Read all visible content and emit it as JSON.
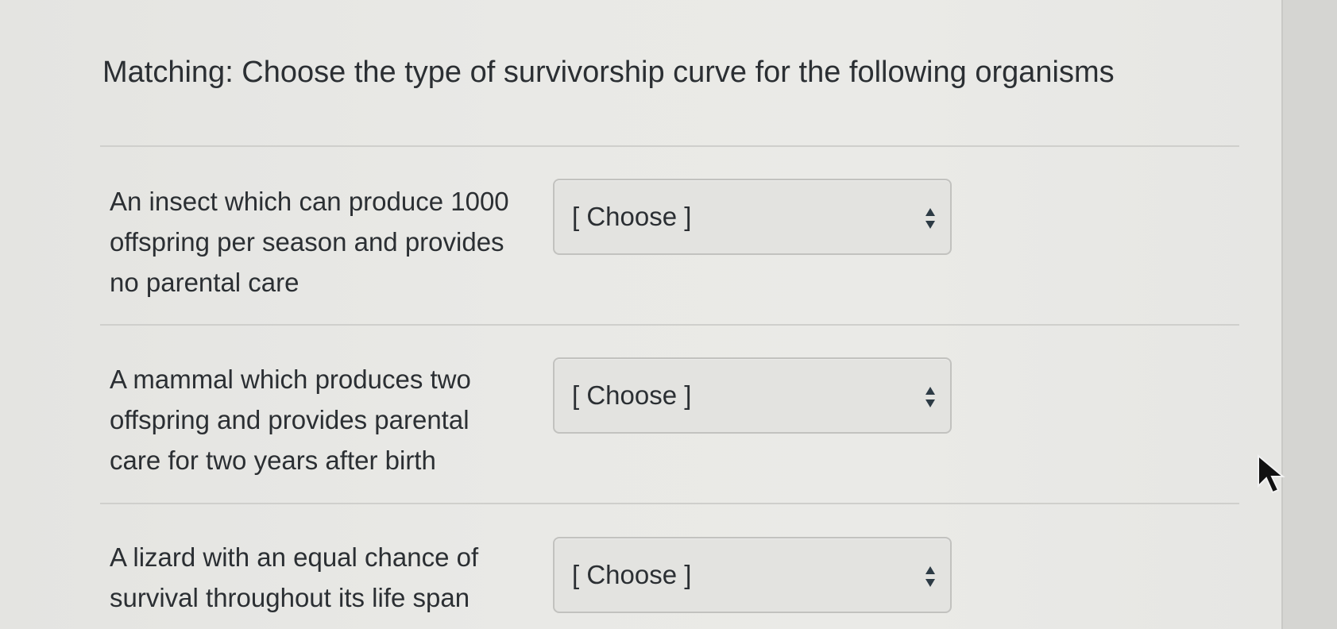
{
  "question": {
    "title": "Matching: Choose the type of survivorship curve for the following organisms"
  },
  "matches": [
    {
      "prompt_lines": [
        "An insect which can produce 1000",
        "offspring per season and provides",
        "no parental care"
      ],
      "selected": "[ Choose ]"
    },
    {
      "prompt_lines": [
        "A mammal which produces two",
        "offspring and provides parental",
        "care for two years after birth"
      ],
      "selected": "[ Choose ]"
    },
    {
      "prompt_lines": [
        "A lizard with an equal chance of",
        "survival throughout its life span"
      ],
      "selected": "[ Choose ]"
    }
  ],
  "icons": {
    "select_arrow": "up-down-caret-icon",
    "cursor": "mouse-pointer-icon"
  }
}
